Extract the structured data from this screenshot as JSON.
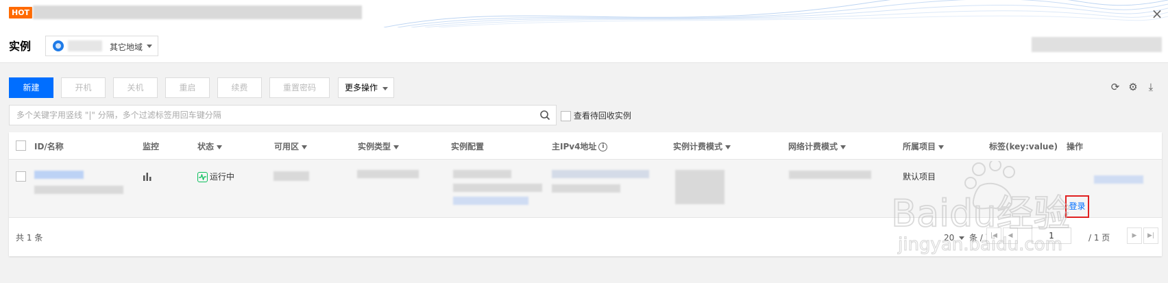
{
  "banner": {
    "badge": "HOT",
    "close_label": "×"
  },
  "header": {
    "title": "实例",
    "region_label": "其它地域"
  },
  "toolbar": {
    "buttons": [
      {
        "label": "新建",
        "enabled": true
      },
      {
        "label": "开机",
        "enabled": false
      },
      {
        "label": "关机",
        "enabled": false
      },
      {
        "label": "重启",
        "enabled": false
      },
      {
        "label": "续费",
        "enabled": false
      },
      {
        "label": "重置密码",
        "enabled": false
      },
      {
        "label": "更多操作",
        "enabled": true
      }
    ],
    "icons": [
      "refresh-icon",
      "gear-icon",
      "download-icon"
    ]
  },
  "search": {
    "placeholder": "多个关键字用竖线 \"|\" 分隔，多个过滤标签用回车键分隔",
    "recycle_label": "查看待回收实例"
  },
  "table": {
    "columns": [
      "ID/名称",
      "监控",
      "状态",
      "可用区",
      "实例类型",
      "实例配置",
      "主IPv4地址",
      "实例计费模式",
      "网络计费模式",
      "所属项目",
      "标签(key:value)",
      "操作"
    ],
    "rows": [
      {
        "status": "运行中",
        "project": "默认项目",
        "action": "登录"
      }
    ]
  },
  "pagination": {
    "total_prefix": "共",
    "total_count": "1",
    "total_suffix": "条",
    "page_size": "20",
    "page_size_suffix": "条 / 页",
    "current_page": "1",
    "total_pages": "/ 1 页"
  },
  "watermark": {
    "brand": "Baidu经验",
    "url": "jingyan.baidu.com"
  },
  "colors": {
    "primary": "#006eff",
    "running": "#0abf5b",
    "highlight": "#e02020",
    "badge": "#ff6a00"
  }
}
